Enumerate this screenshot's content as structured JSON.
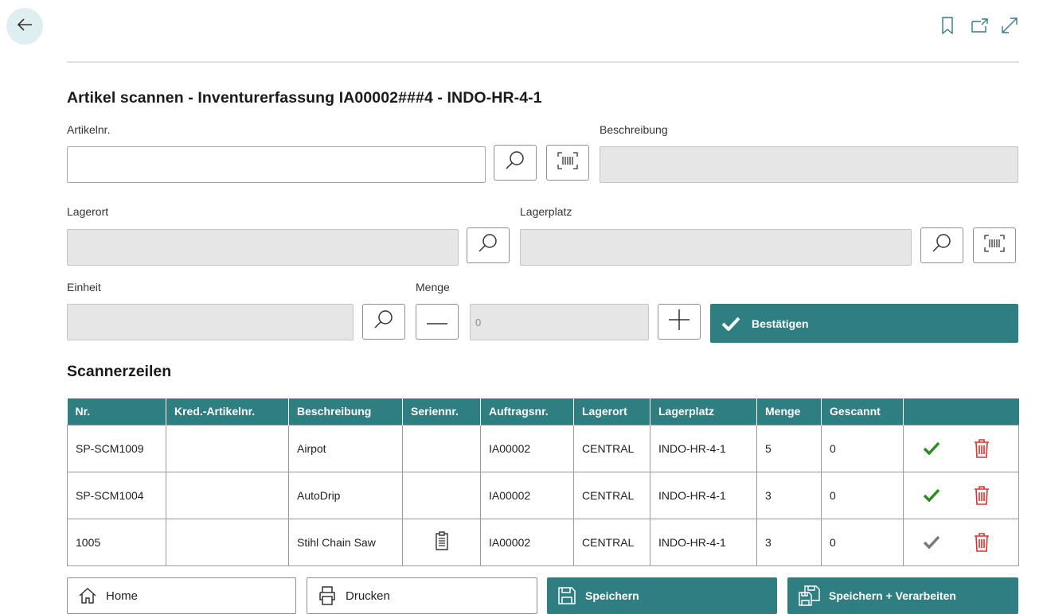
{
  "page": {
    "title": "Artikel scannen - Inventurerfassung IA00002###4 - INDO-HR-4-1"
  },
  "fields": {
    "artikelnr": {
      "label": "Artikelnr.",
      "value": ""
    },
    "beschreibung": {
      "label": "Beschreibung",
      "value": ""
    },
    "lagerort": {
      "label": "Lagerort",
      "value": ""
    },
    "lagerplatz": {
      "label": "Lagerplatz",
      "value": ""
    },
    "einheit": {
      "label": "Einheit",
      "value": ""
    },
    "menge": {
      "label": "Menge",
      "value": "0"
    }
  },
  "actions": {
    "confirm_label": "Bestätigen"
  },
  "scanner": {
    "section_title": "Scannerzeilen",
    "columns": [
      "Nr.",
      "Kred.-Artikelnr.",
      "Beschreibung",
      "Seriennr.",
      "Auftragsnr.",
      "Lagerort",
      "Lagerplatz",
      "Menge",
      "Gescannt"
    ],
    "rows": [
      {
        "nr": "SP-SCM1009",
        "kred": "",
        "beschreibung": "Airpot",
        "seriennr_icon": "",
        "auftragsnr": "IA00002",
        "lagerort": "CENTRAL",
        "lagerplatz": "INDO-HR-4-1",
        "menge": "5",
        "gescannt": "0",
        "check_color": "#2e8b20"
      },
      {
        "nr": "SP-SCM1004",
        "kred": "",
        "beschreibung": "AutoDrip",
        "seriennr_icon": "",
        "auftragsnr": "IA00002",
        "lagerort": "CENTRAL",
        "lagerplatz": "INDO-HR-4-1",
        "menge": "3",
        "gescannt": "0",
        "check_color": "#2e8b20"
      },
      {
        "nr": "1005",
        "kred": "",
        "beschreibung": "Stihl Chain Saw",
        "seriennr_icon": "clipboard-icon",
        "auftragsnr": "IA00002",
        "lagerort": "CENTRAL",
        "lagerplatz": "INDO-HR-4-1",
        "menge": "3",
        "gescannt": "0",
        "check_color": "#7a7a7a"
      }
    ]
  },
  "footer": {
    "home_label": "Home",
    "print_label": "Drucken",
    "save_label": "Speichern",
    "save_process_label": "Speichern + Verarbeiten"
  },
  "icons": {
    "back": "arrow-left-icon",
    "bookmark": "bookmark-icon",
    "open_new": "open-in-new-window-icon",
    "expand": "expand-icon",
    "search": "search-icon",
    "barcode": "barcode-scan-icon",
    "minus": "minus-icon",
    "plus": "plus-icon",
    "check": "checkmark-icon",
    "delete": "trash-icon",
    "home": "home-icon",
    "print": "printer-icon",
    "save": "floppy-disk-icon",
    "save_process": "save-and-process-icon"
  },
  "colors": {
    "accent": "#2f7f82",
    "delete": "#e0302a",
    "check_active": "#2e8b20",
    "check_inactive": "#7a7a7a"
  }
}
